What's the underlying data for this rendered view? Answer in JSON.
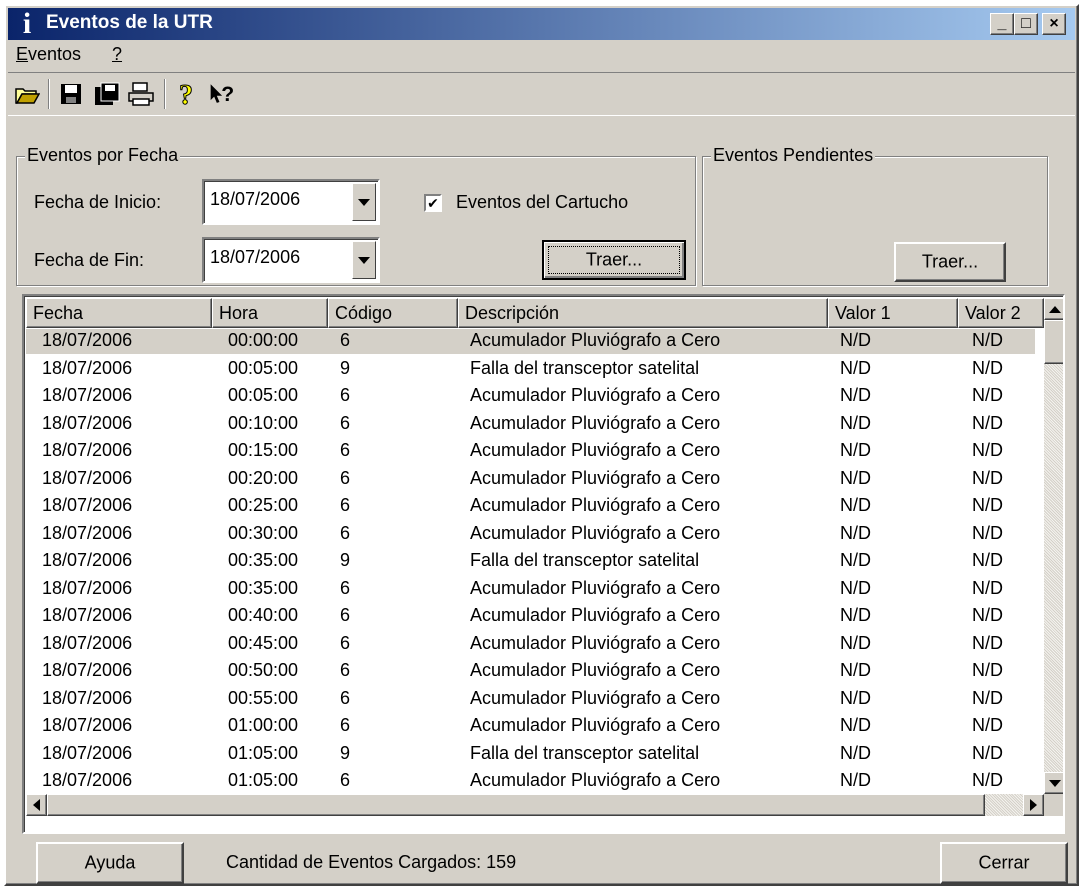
{
  "window": {
    "title": "Eventos de la UTR",
    "title_icon": "i",
    "controls": {
      "minimize": "_",
      "maximize": "□",
      "close": "×"
    }
  },
  "menu": {
    "items": [
      {
        "label": "Eventos",
        "mnemonic": "E"
      },
      {
        "label": "?",
        "mnemonic": "?"
      }
    ]
  },
  "toolbar": {
    "icons": [
      "open-folder-icon",
      "save-disk-icon",
      "save-all-icon",
      "print-icon",
      "help-icon",
      "context-help-icon"
    ]
  },
  "por_fecha": {
    "title": "Eventos por Fecha",
    "inicio_label": "Fecha de Inicio:",
    "inicio_value": "18/07/2006",
    "fin_label": "Fecha de Fin:",
    "fin_value": "18/07/2006",
    "cartucho_label": "Eventos del Cartucho",
    "cartucho_checked": true,
    "traer_label": "Traer..."
  },
  "pendientes": {
    "title": "Eventos Pendientes",
    "traer_label": "Traer..."
  },
  "table": {
    "columns": [
      "Fecha",
      "Hora",
      "Código",
      "Descripción",
      "Valor 1",
      "Valor 2"
    ],
    "rows": [
      [
        "18/07/2006",
        "00:00:00",
        "6",
        "Acumulador Pluviógrafo a Cero",
        "N/D",
        "N/D"
      ],
      [
        "18/07/2006",
        "00:05:00",
        "9",
        "Falla del transceptor satelital",
        "N/D",
        "N/D"
      ],
      [
        "18/07/2006",
        "00:05:00",
        "6",
        "Acumulador Pluviógrafo a Cero",
        "N/D",
        "N/D"
      ],
      [
        "18/07/2006",
        "00:10:00",
        "6",
        "Acumulador Pluviógrafo a Cero",
        "N/D",
        "N/D"
      ],
      [
        "18/07/2006",
        "00:15:00",
        "6",
        "Acumulador Pluviógrafo a Cero",
        "N/D",
        "N/D"
      ],
      [
        "18/07/2006",
        "00:20:00",
        "6",
        "Acumulador Pluviógrafo a Cero",
        "N/D",
        "N/D"
      ],
      [
        "18/07/2006",
        "00:25:00",
        "6",
        "Acumulador Pluviógrafo a Cero",
        "N/D",
        "N/D"
      ],
      [
        "18/07/2006",
        "00:30:00",
        "6",
        "Acumulador Pluviógrafo a Cero",
        "N/D",
        "N/D"
      ],
      [
        "18/07/2006",
        "00:35:00",
        "9",
        "Falla del transceptor satelital",
        "N/D",
        "N/D"
      ],
      [
        "18/07/2006",
        "00:35:00",
        "6",
        "Acumulador Pluviógrafo a Cero",
        "N/D",
        "N/D"
      ],
      [
        "18/07/2006",
        "00:40:00",
        "6",
        "Acumulador Pluviógrafo a Cero",
        "N/D",
        "N/D"
      ],
      [
        "18/07/2006",
        "00:45:00",
        "6",
        "Acumulador Pluviógrafo a Cero",
        "N/D",
        "N/D"
      ],
      [
        "18/07/2006",
        "00:50:00",
        "6",
        "Acumulador Pluviógrafo a Cero",
        "N/D",
        "N/D"
      ],
      [
        "18/07/2006",
        "00:55:00",
        "6",
        "Acumulador Pluviógrafo a Cero",
        "N/D",
        "N/D"
      ],
      [
        "18/07/2006",
        "01:00:00",
        "6",
        "Acumulador Pluviógrafo a Cero",
        "N/D",
        "N/D"
      ],
      [
        "18/07/2006",
        "01:05:00",
        "9",
        "Falla del transceptor satelital",
        "N/D",
        "N/D"
      ],
      [
        "18/07/2006",
        "01:05:00",
        "6",
        "Acumulador Pluviógrafo a Cero",
        "N/D",
        "N/D"
      ]
    ]
  },
  "footer": {
    "ayuda_label": "Ayuda",
    "status_text": "Cantidad de Eventos Cargados: 159",
    "cerrar_label": "Cerrar"
  }
}
